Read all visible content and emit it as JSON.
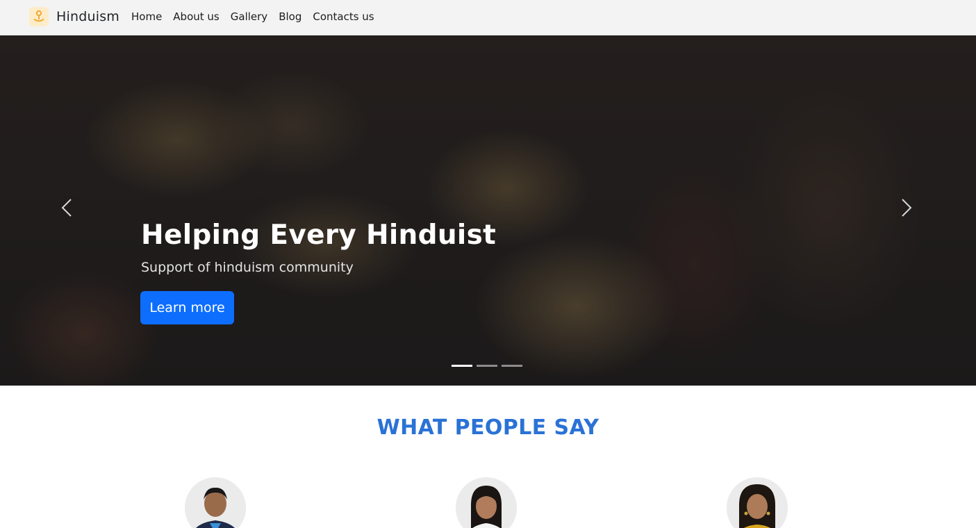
{
  "navbar": {
    "brand": "Hinduism",
    "links": [
      "Home",
      "About us",
      "Gallery",
      "Blog",
      "Contacts us"
    ]
  },
  "hero": {
    "title": "Helping Every Hinduist",
    "subtitle": "Support of hinduism community",
    "button_label": "Learn more",
    "slides_count": 3,
    "active_slide": 1
  },
  "testimonials": {
    "title": "WHAT PEOPLE SAY"
  },
  "colors": {
    "navbar_bg": "#f3f3f3",
    "accent": "#0d6efd",
    "section_title": "#2a72d6",
    "logo_bg": "#fdecc8",
    "logo_icon": "#f0a42b"
  },
  "icons": [
    "temple-pin-icon",
    "chevron-left-icon",
    "chevron-right-icon"
  ]
}
